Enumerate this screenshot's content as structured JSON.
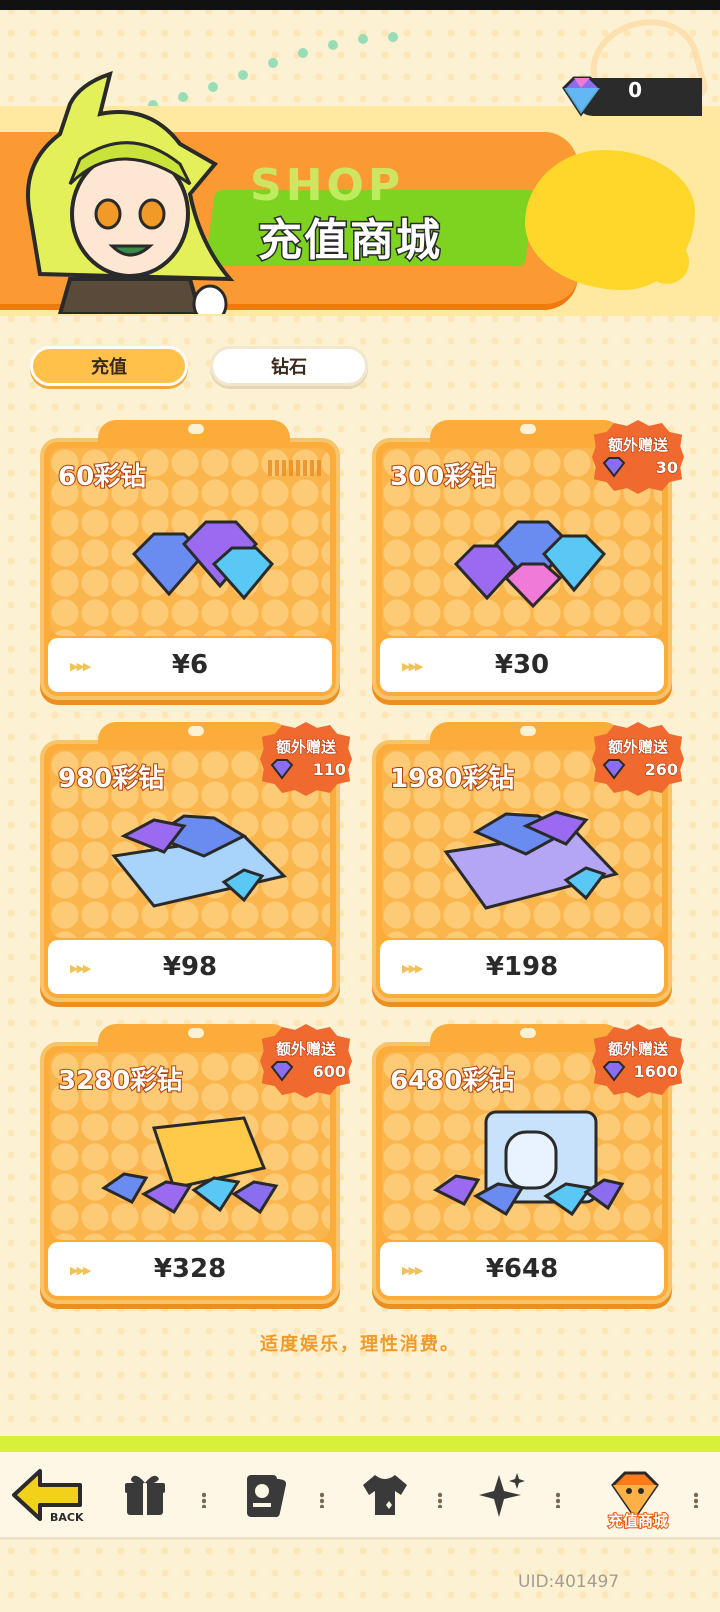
{
  "header": {
    "shop_label": "SHOP",
    "title": "充值商城"
  },
  "currency": {
    "icon": "diamond-icon",
    "value": "0"
  },
  "tabs": [
    {
      "label": "充值",
      "active": true
    },
    {
      "label": "钻石",
      "active": false
    }
  ],
  "packs": [
    {
      "name": "60彩钻",
      "price": "¥6",
      "bonus_label": "",
      "bonus": ""
    },
    {
      "name": "300彩钻",
      "price": "¥30",
      "bonus_label": "额外赠送",
      "bonus": "30"
    },
    {
      "name": "980彩钻",
      "price": "¥98",
      "bonus_label": "额外赠送",
      "bonus": "110"
    },
    {
      "name": "1980彩钻",
      "price": "¥198",
      "bonus_label": "额外赠送",
      "bonus": "260"
    },
    {
      "name": "3280彩钻",
      "price": "¥328",
      "bonus_label": "额外赠送",
      "bonus": "600"
    },
    {
      "name": "6480彩钻",
      "price": "¥648",
      "bonus_label": "额外赠送",
      "bonus": "1600"
    }
  ],
  "notice": "适度娱乐，理性消费。",
  "nav": {
    "back_label": "BACK",
    "items": [
      "back-icon",
      "gift-icon",
      "card-icon",
      "shirt-icon",
      "sparkle-icon",
      "shop-icon"
    ],
    "active_label": "充值商城"
  },
  "uid": "UID:401497",
  "colors": {
    "background": "#fdf1d3",
    "card": "#fbac3b",
    "header_orange": "#fb9a33",
    "accent_green": "#7ed321",
    "bonus_badge": "#f06a30",
    "nav_lime": "#d7f03a"
  }
}
